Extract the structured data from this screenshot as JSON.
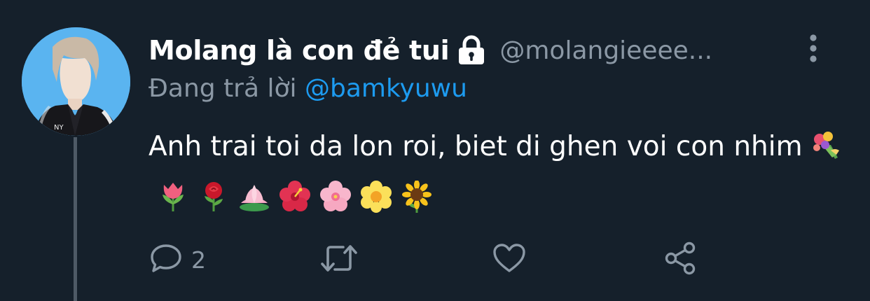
{
  "tweet": {
    "display_name": "Molang là con đẻ tui",
    "handle": "@molangieeee...",
    "reply_prefix": "Đang trả lời",
    "reply_to": "@bamkyuwu",
    "text": "Anh trai toi da lon roi, biet di ghen voi con nhim",
    "emojis": [
      "bouquet-emoji",
      "tulip-emoji",
      "rose-emoji",
      "lotus-emoji",
      "hibiscus-emoji",
      "cherry-blossom-emoji",
      "blossom-emoji",
      "sunflower-emoji"
    ]
  },
  "actions": {
    "reply_count": "2",
    "icons": [
      "reply-icon",
      "retweet-icon",
      "like-icon",
      "share-icon"
    ]
  },
  "colors": {
    "background": "#15202b",
    "primary_text": "#ffffff",
    "secondary_text": "#8b98a5",
    "accent": "#1d9bf0",
    "thread_line": "#4e5a66",
    "avatar_bg": "#5ab4f0"
  }
}
